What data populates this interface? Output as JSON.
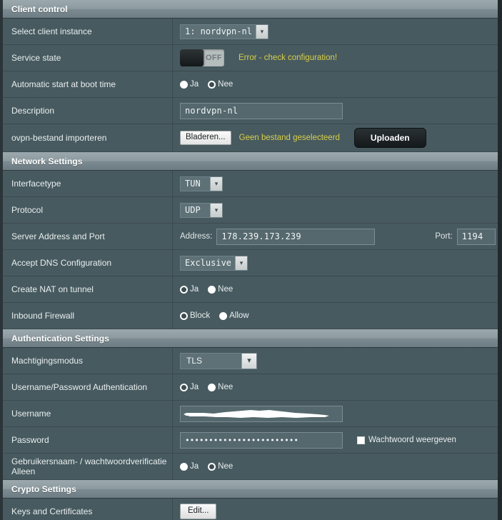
{
  "sections": [
    {
      "id": "client_control",
      "title": "Client control"
    },
    {
      "id": "network_settings",
      "title": "Network Settings"
    },
    {
      "id": "authentication_settings",
      "title": "Authentication Settings"
    },
    {
      "id": "crypto_settings",
      "title": "Crypto Settings"
    }
  ],
  "client_control": {
    "select_client_instance": {
      "label": "Select client instance",
      "value": "1: nordvpn-nl"
    },
    "service_state": {
      "label": "Service state",
      "toggle_state": "OFF",
      "toggle_on": false,
      "error_text": "Error - check configuration!"
    },
    "auto_start": {
      "label": "Automatic start at boot time",
      "options": [
        "Ja",
        "Nee"
      ],
      "selected": "Ja"
    },
    "description": {
      "label": "Description",
      "value": "nordvpn-nl"
    },
    "import_ovpn": {
      "label": "ovpn-bestand importeren",
      "browse_label": "Bladeren...",
      "file_status": "Geen bestand geselecteerd",
      "upload_label": "Uploaden"
    }
  },
  "network_settings": {
    "interface_type": {
      "label": "Interfacetype",
      "value": "TUN"
    },
    "protocol": {
      "label": "Protocol",
      "value": "UDP"
    },
    "server_address_port": {
      "label": "Server Address and Port",
      "address_label": "Address:",
      "address_value": "178.239.173.239",
      "port_label": "Port:",
      "port_value": "1194"
    },
    "accept_dns": {
      "label": "Accept DNS Configuration",
      "value": "Exclusive"
    },
    "create_nat": {
      "label": "Create NAT on tunnel",
      "options": [
        "Ja",
        "Nee"
      ],
      "selected": "Nee"
    },
    "inbound_firewall": {
      "label": "Inbound Firewall",
      "options": [
        "Block",
        "Allow"
      ],
      "selected": "Allow"
    }
  },
  "authentication_settings": {
    "auth_mode": {
      "label": "Machtigingsmodus",
      "value": "TLS"
    },
    "userpass_auth": {
      "label": "Username/Password Authentication",
      "options": [
        "Ja",
        "Nee"
      ],
      "selected": "Nee"
    },
    "username": {
      "label": "Username",
      "value": ""
    },
    "password": {
      "label": "Password",
      "value": "••••••••••••••••••••••••",
      "show_password_label": "Wachtwoord weergeven",
      "show_password_checked": false
    },
    "userpass_only": {
      "label": "Gebruikersnaam- / wachtwoordverificatie Alleen",
      "options": [
        "Ja",
        "Nee"
      ],
      "selected": "Ja"
    }
  },
  "crypto_settings": {
    "keys_and_certs": {
      "label": "Keys and Certificates",
      "button_label": "Edit..."
    }
  },
  "icons": {
    "chevron_down": "chevron-down-icon"
  },
  "colors": {
    "page_bg": "#475a5f",
    "header_band": "#8d9ba0",
    "accent_warning": "#d8cf4a",
    "text": "#e9eff0"
  }
}
